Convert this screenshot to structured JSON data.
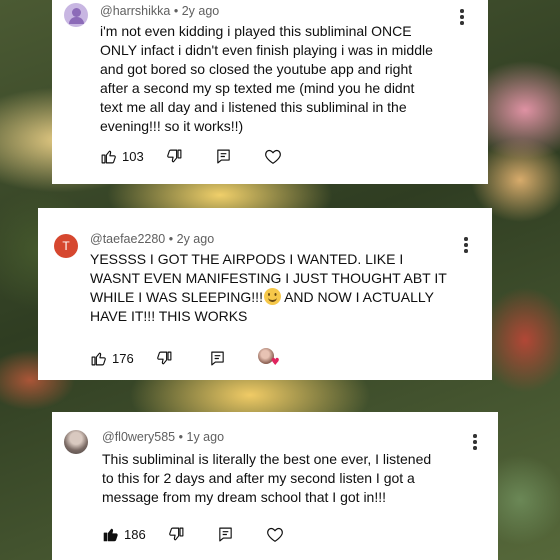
{
  "comments": [
    {
      "handle": "@harrshikka",
      "age": "2y ago",
      "avatar_icon": "person-icon",
      "text": "i'm not even kidding i played this subliminal ONCE\nONLY infact i didn't even finish playing i was in middle\nand got bored so closed the youtube app and right\nafter a second my sp texted me (mind you he didnt\ntext me all day and i listened this subliminal in the\nevening!!! so it works!!)",
      "likes": "103"
    },
    {
      "handle": "@taefae2280",
      "age": "2y ago",
      "avatar_letter": "T",
      "text_lines": [
        "YESSSS I GOT THE AIRPODS I WANTED. LIKE I",
        "WASNT EVEN MANIFESTING I JUST THOUGHT ABT IT",
        "WHILE I WAS SLEEPING!!!",
        " AND NOW I ACTUALLY",
        "HAVE IT!!! THIS WORKS"
      ],
      "emoji": "smiling-face-emoji",
      "likes": "176",
      "creator_heart": "creator-heart-icon"
    },
    {
      "handle": "@fl0wery585",
      "age": "1y ago",
      "text": "This subliminal is literally the best one ever, I listened\nto this for 2 days and after my second listen I got a\nmessage from my dream school that I got in!!!",
      "likes": "186"
    }
  ],
  "separator": "•",
  "colors": {
    "red_avatar": "#d6472f",
    "heart": "#e0245e",
    "meta_text": "#606060"
  }
}
